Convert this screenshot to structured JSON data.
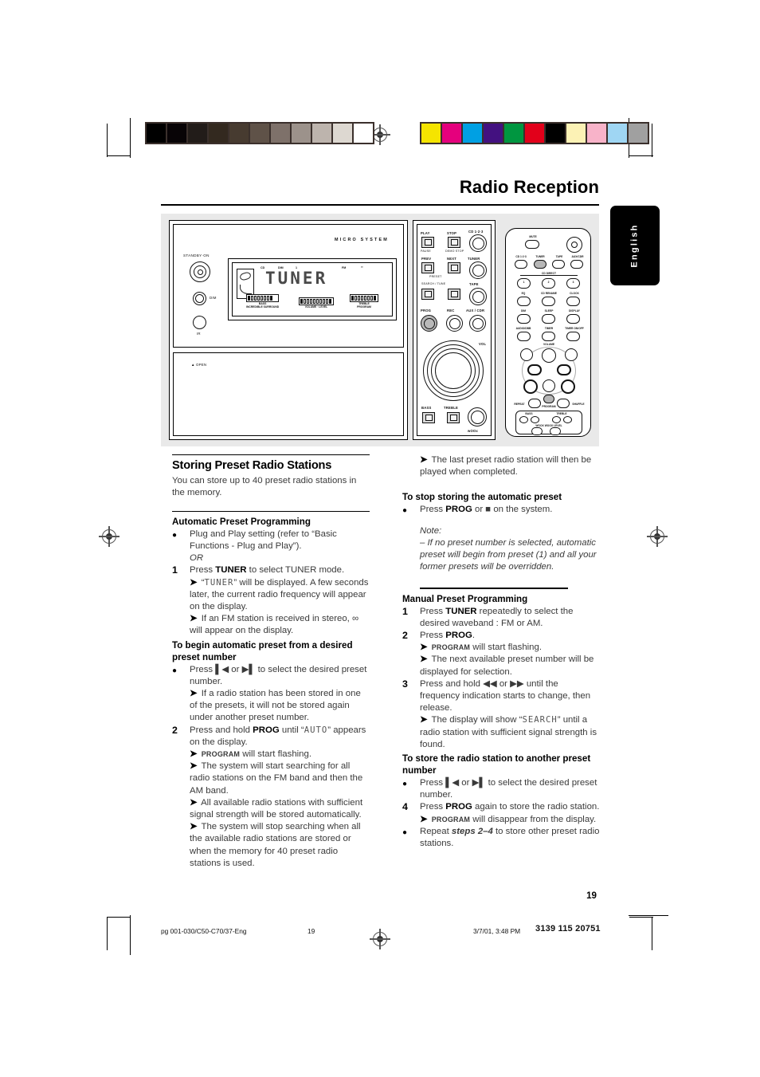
{
  "header": {
    "title": "Radio Reception",
    "language_tab": "English"
  },
  "illustration": {
    "unit": {
      "brand_text": "MICRO SYSTEM",
      "standby_label": "STANDBY·ON",
      "dim_label": "DIM",
      "ir_label": "IR",
      "open_label": "OPEN",
      "display": {
        "main_text": "TUNER",
        "indicators": [
          "CD",
          "DIM",
          "1",
          "FM",
          "∞"
        ],
        "bass_label": "BASS",
        "incredible_surround_label": "INCREDIBLE SURROUND",
        "volume_label": "VOLUME · LEVEL",
        "treble_label": "TREBLE",
        "program_label": "PROGRAM"
      }
    },
    "control_panel": {
      "play_label": "PLAY",
      "pause_label": "PAUSE",
      "stop_label": "STOP",
      "demo_stop_label": "DEMO STOP",
      "cd_label": "CD 1·2·3",
      "prev_label": "PREV",
      "next_label": "NEXT",
      "preset_label": "PRESET",
      "tuner_label": "TUNER",
      "search_tune_label": "SEARCH / TUNE",
      "tape_label": "TAPE",
      "prog_label": "PROG",
      "rec_label": "REC",
      "aux_cdr_label": "AUX / CDR",
      "vol_label": "VOL",
      "bass_label": "BASS",
      "treble_label": "TREBLE",
      "woox_label": "wOOx"
    },
    "remote": {
      "mute_label": "MUTE",
      "source_labels": [
        "CD 1·2·3",
        "TUNER",
        "TAPE",
        "AUX/CDR"
      ],
      "cd_direct_label": "CD DIRECT",
      "number_labels": [
        "1",
        "2",
        "3"
      ],
      "row3_labels": [
        "EQ",
        "CD RENAME",
        "CLOCK"
      ],
      "row4_labels": [
        "DIM",
        "SLEEP",
        "DISPLAY"
      ],
      "row5_labels": [
        "AUDIO/DBB",
        "TIMER",
        "TIMER ON/OFF"
      ],
      "volume_label": "VOLUME",
      "repeat_label": "REPEAT",
      "program_label": "PROGRAM",
      "shuffle_label": "SHUFFLE",
      "bass_label": "BASS",
      "treble_label": "TREBLE",
      "woox_label": "WOOX",
      "woox_level_label": "WOOX LEVEL"
    }
  },
  "left_column": {
    "section_title": "Storing Preset Radio Stations",
    "intro": "You can store up to 40 preset radio stations in the memory.",
    "sub_title": "Automatic Preset Programming",
    "items": [
      {
        "marker": "●",
        "lines": [
          "Plug and Play setting (refer to “Basic Functions - Plug and Play”).",
          "OR"
        ]
      },
      {
        "marker": "1",
        "lines": [
          "Press TUNER to select TUNER mode.",
          "➔ “TUNER” will be displayed.  A few seconds later, the current radio frequency will appear on the display.",
          "➔ If an FM station is received in stereo, ∞ will appear on the display."
        ]
      }
    ],
    "sub_title_2": "To begin automatic preset from a desired preset number",
    "items_2": [
      {
        "marker": "●",
        "lines": [
          "Press ❘◀ or ▶❘ to select the desired preset number.",
          "➔ If a radio station has been stored in one of the presets, it will not be stored again under another preset number."
        ]
      },
      {
        "marker": "2",
        "lines": [
          "Press and hold PROG until “AUTO” appears on the display.",
          "➔ PROGRAM will start flashing.",
          "➔ The system will start searching for all radio stations on the FM band and then the AM band.",
          "➔ All available radio stations with sufficient signal strength will be stored automatically.",
          "➔ The system will stop searching when all the available radio stations are stored or when the memory for 40 preset radio stations is used."
        ]
      }
    ]
  },
  "right_column": {
    "lead_arrow": "➔ The last preset radio station will then be played when completed.",
    "stop_title": "To stop storing the automatic preset",
    "stop_item": "Press PROG or ■ on the system.",
    "note_label": "Note:",
    "note_body": "–  If no preset number is selected, automatic preset will begin from preset (1) and all your former presets will be overridden.",
    "manual_title": "Manual Preset Programming",
    "items": [
      {
        "marker": "1",
        "lines": [
          "Press TUNER repeatedly to select the desired waveband : FM or AM."
        ]
      },
      {
        "marker": "2",
        "lines": [
          "Press PROG.",
          "➔ PROGRAM will start flashing.",
          "➔ The next available preset number will be displayed for selection."
        ]
      },
      {
        "marker": "3",
        "lines": [
          "Press and hold ◀◀ or ▶▶ until the frequency indication starts to change, then release.",
          "➔ The display will show “SEARCH” until a radio station with sufficient signal strength is found."
        ]
      }
    ],
    "store_title": "To store the radio station to another preset number",
    "items_2": [
      {
        "marker": "●",
        "lines": [
          "Press ❘◀ or ▶❘ to select the desired preset number."
        ]
      },
      {
        "marker": "4",
        "lines": [
          "Press PROG again to store the radio station.",
          "➔ PROGRAM will disappear from the display."
        ]
      },
      {
        "marker": "●",
        "lines": [
          "Repeat steps 2–4 to store other preset radio stations."
        ]
      }
    ]
  },
  "footer": {
    "page_number": "19",
    "file_name": "pg 001-030/C50-C70/37-Eng",
    "page_marker": "19",
    "date": "3/7/01, 3:48 PM",
    "code": "3139 115 20751"
  },
  "calibration": {
    "grayscale": [
      "#000000",
      "#080406",
      "#221c19",
      "#33291f",
      "#473b30",
      "#5f5248",
      "#7e716a",
      "#9c928b",
      "#bdb4ad",
      "#ddd8d1",
      "#ffffff"
    ],
    "colors": [
      "#f5e400",
      "#e5007d",
      "#00a0e3",
      "#431180",
      "#009640",
      "#e2001a",
      "#000000",
      "#fcf2b5",
      "#f8b3c9",
      "#9fd6f3",
      "#a0a0a0"
    ]
  }
}
